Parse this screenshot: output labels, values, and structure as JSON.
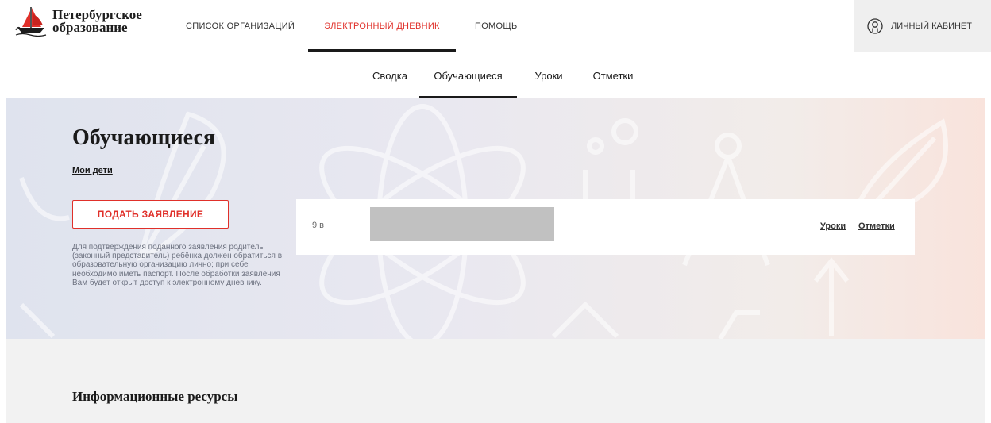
{
  "header": {
    "logo_line1": "Петербургское",
    "logo_line2": "образование",
    "nav": [
      {
        "label": "СПИСОК ОРГАНИЗАЦИЙ"
      },
      {
        "label": "ЭЛЕКТРОННЫЙ ДНЕВНИК",
        "active": true
      },
      {
        "label": "ПОМОЩЬ"
      }
    ],
    "cabinet_label": "ЛИЧНЫЙ КАБИНЕТ",
    "cabinet_icon": "user-circle-icon"
  },
  "subnav": [
    {
      "label": "Сводка"
    },
    {
      "label": "Обучающиеся",
      "active": true
    },
    {
      "label": "Уроки"
    },
    {
      "label": "Отметки"
    }
  ],
  "hero": {
    "title": "Обучающиеся",
    "my_children": "Мои дети",
    "apply_button": "ПОДАТЬ ЗАЯВЛЕНИЕ",
    "note": "Для подтверждения поданного заявления родитель (законный представитель) ребёнка должен обратиться в образовательную организацию лично; при себе необходимо иметь паспорт. После обработки заявления Вам будет открыт доступ к электронному дневнику."
  },
  "students": [
    {
      "class": "9 в",
      "lessons_link": "Уроки",
      "marks_link": "Отметки"
    }
  ],
  "info": {
    "title": "Информационные ресурсы"
  },
  "colors": {
    "accent": "#e0302a",
    "dark": "#1a1a1a",
    "cabinet_bg": "#efefef",
    "info_bg": "#f2f2f2",
    "redacted": "#c1c1c1"
  }
}
